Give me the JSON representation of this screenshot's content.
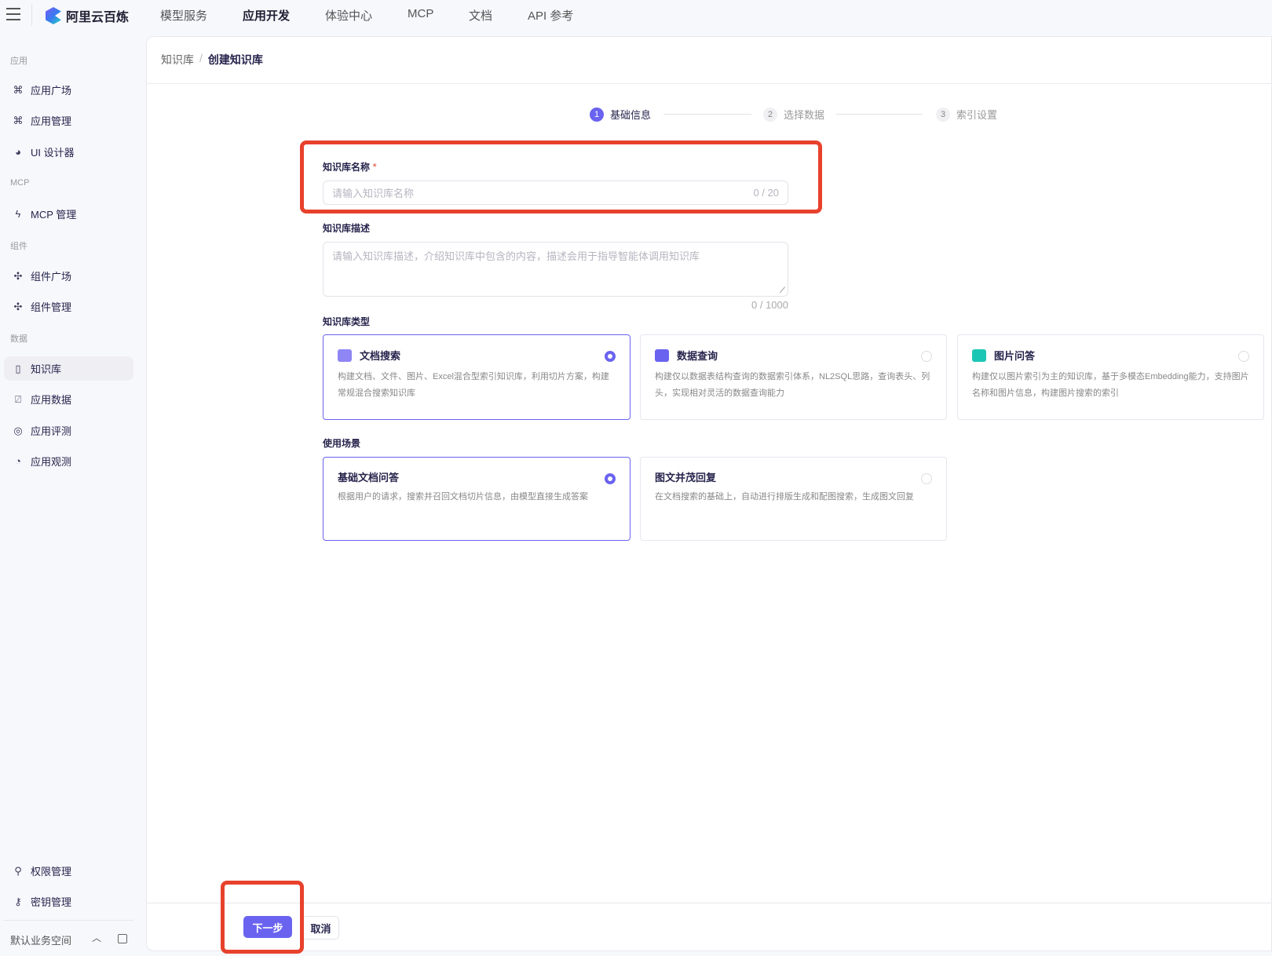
{
  "topbar": {
    "brand": "阿里云百炼",
    "nav": [
      "模型服务",
      "应用开发",
      "体验中心",
      "MCP",
      "文档",
      "API 参考"
    ],
    "active": "应用开发"
  },
  "sidebar": {
    "sections": [
      "应用",
      "MCP",
      "组件",
      "数据"
    ],
    "items": [
      {
        "label": "应用广场",
        "icon": "apps-icon"
      },
      {
        "label": "应用管理",
        "icon": "apps-manage-icon"
      },
      {
        "label": "UI 设计器",
        "icon": "palette-icon"
      },
      {
        "label": "MCP 管理",
        "icon": "mcp-icon"
      },
      {
        "label": "组件广场",
        "icon": "puzzle-icon"
      },
      {
        "label": "组件管理",
        "icon": "puzzle-gear-icon"
      },
      {
        "label": "知识库",
        "icon": "book-icon"
      },
      {
        "label": "应用数据",
        "icon": "chart-icon"
      },
      {
        "label": "应用评测",
        "icon": "compass-icon"
      },
      {
        "label": "应用观测",
        "icon": "pie-icon"
      }
    ],
    "bottom": [
      {
        "label": "权限管理",
        "icon": "user-icon"
      },
      {
        "label": "密钥管理",
        "icon": "key-icon"
      }
    ],
    "workspace": "默认业务空间"
  },
  "breadcrumb": {
    "parent": "知识库",
    "sep": "/",
    "current": "创建知识库"
  },
  "steps": [
    {
      "num": "1",
      "label": "基础信息"
    },
    {
      "num": "2",
      "label": "选择数据"
    },
    {
      "num": "3",
      "label": "索引设置"
    }
  ],
  "form": {
    "name_label": "知识库名称",
    "required": "*",
    "name_placeholder": "请输入知识库名称",
    "name_count": "0 / 20",
    "desc_label": "知识库描述",
    "desc_placeholder": "请输入知识库描述，介绍知识库中包含的内容，描述会用于指导智能体调用知识库",
    "desc_count": "0 / 1000",
    "type_label": "知识库类型",
    "types": [
      {
        "title": "文档搜索",
        "desc": "构建文档、文件、图片、Excel混合型索引知识库，利用切片方案，构建常规混合搜索知识库",
        "selected": true,
        "color": "#8f86f5"
      },
      {
        "title": "数据查询",
        "desc": "构建仅以数据表结构查询的数据索引体系，NL2SQL思路，查询表头、列头，实现相对灵活的数据查询能力",
        "selected": false,
        "color": "#6a63f0"
      },
      {
        "title": "图片问答",
        "desc": "构建仅以图片索引为主的知识库，基于多模态Embedding能力，支持图片名称和图片信息，构建图片搜索的索引",
        "selected": false,
        "color": "#1cc6b4"
      }
    ],
    "scene_label": "使用场景",
    "scenes": [
      {
        "title": "基础文档问答",
        "desc": "根据用户的请求，搜索并召回文档切片信息，由模型直接生成答案",
        "selected": true
      },
      {
        "title": "图文并茂回复",
        "desc": "在文档搜索的基础上，自动进行排版生成和配图搜索，生成图文回复",
        "selected": false
      }
    ]
  },
  "footer": {
    "next": "下一步",
    "cancel": "取消"
  },
  "colors": {
    "accent": "#6a63f0",
    "highlight": "#e8412c"
  }
}
